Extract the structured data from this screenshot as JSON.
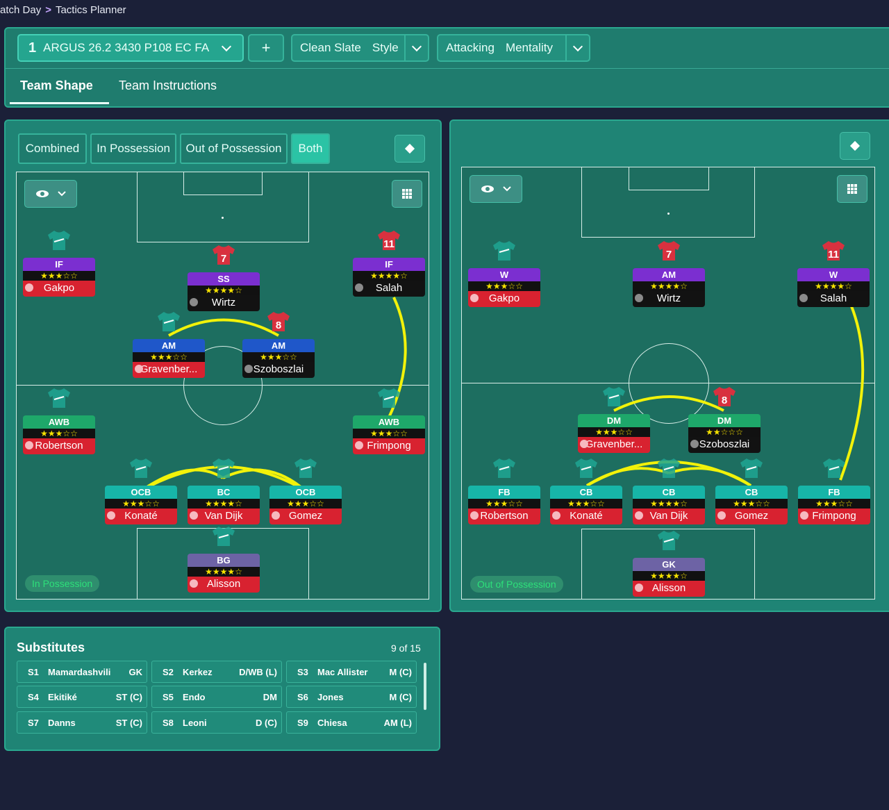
{
  "breadcrumb": {
    "parent": "atch Day",
    "current": "Tactics Planner"
  },
  "tactic": {
    "number": "1",
    "name": "ARGUS 26.2 3430 P108 EC FA",
    "add_label": "+"
  },
  "style": {
    "value": "Clean Slate",
    "label": "Style"
  },
  "mentality": {
    "value": "Attacking",
    "label": "Mentality"
  },
  "tabs": [
    "Team Shape",
    "Team Instructions"
  ],
  "view_modes": [
    "Combined",
    "In Possession",
    "Out of Possession",
    "Both"
  ],
  "active_view": "Both",
  "left_pitch": {
    "tag": "In Possession"
  },
  "right_pitch": {
    "tag": "Out of Possession"
  },
  "in_possession_players": [
    {
      "role": "IF",
      "stars": "★★★☆☆",
      "name": "Gakpo",
      "number": ""
    },
    {
      "role": "SS",
      "stars": "★★★★☆",
      "name": "Wirtz",
      "number": "7"
    },
    {
      "role": "IF",
      "stars": "★★★★☆",
      "name": "Salah",
      "number": "11"
    },
    {
      "role": "AM",
      "stars": "★★★☆☆",
      "name": "Gravenber...",
      "number": ""
    },
    {
      "role": "AM",
      "stars": "★★★☆☆",
      "name": "Szoboszlai",
      "number": "8"
    },
    {
      "role": "AWB",
      "stars": "★★★☆☆",
      "name": "Robertson",
      "number": ""
    },
    {
      "role": "AWB",
      "stars": "★★★☆☆",
      "name": "Frimpong",
      "number": ""
    },
    {
      "role": "OCB",
      "stars": "★★★☆☆",
      "name": "Konaté",
      "number": ""
    },
    {
      "role": "BC",
      "stars": "★★★★☆",
      "name": "Van Dijk",
      "number": ""
    },
    {
      "role": "OCB",
      "stars": "★★★☆☆",
      "name": "Gomez",
      "number": ""
    },
    {
      "role": "BG",
      "stars": "★★★★☆",
      "name": "Alisson",
      "number": ""
    }
  ],
  "out_possession_players": [
    {
      "role": "W",
      "stars": "★★★☆☆",
      "name": "Gakpo",
      "number": ""
    },
    {
      "role": "AM",
      "stars": "★★★★☆",
      "name": "Wirtz",
      "number": "7"
    },
    {
      "role": "W",
      "stars": "★★★★☆",
      "name": "Salah",
      "number": "11"
    },
    {
      "role": "DM",
      "stars": "★★★☆☆",
      "name": "Gravenber...",
      "number": ""
    },
    {
      "role": "DM",
      "stars": "★★☆☆☆",
      "name": "Szoboszlai",
      "number": "8"
    },
    {
      "role": "FB",
      "stars": "★★★☆☆",
      "name": "Robertson",
      "number": ""
    },
    {
      "role": "CB",
      "stars": "★★★☆☆",
      "name": "Konaté",
      "number": ""
    },
    {
      "role": "CB",
      "stars": "★★★★☆",
      "name": "Van Dijk",
      "number": ""
    },
    {
      "role": "CB",
      "stars": "★★★☆☆",
      "name": "Gomez",
      "number": ""
    },
    {
      "role": "FB",
      "stars": "★★★☆☆",
      "name": "Frimpong",
      "number": ""
    },
    {
      "role": "GK",
      "stars": "★★★★☆",
      "name": "Alisson",
      "number": ""
    }
  ],
  "substitutes": {
    "title": "Substitutes",
    "count": "9 of 15",
    "items": [
      {
        "slot": "S1",
        "name": "Mamardashvili",
        "pos": "GK"
      },
      {
        "slot": "S2",
        "name": "Kerkez",
        "pos": "D/WB (L)"
      },
      {
        "slot": "S3",
        "name": "Mac Allister",
        "pos": "M (C)"
      },
      {
        "slot": "S4",
        "name": "Ekitiké",
        "pos": "ST (C)"
      },
      {
        "slot": "S5",
        "name": "Endo",
        "pos": "DM"
      },
      {
        "slot": "S6",
        "name": "Jones",
        "pos": "M (C)"
      },
      {
        "slot": "S7",
        "name": "Danns",
        "pos": "ST (C)"
      },
      {
        "slot": "S8",
        "name": "Leoni",
        "pos": "D (C)"
      },
      {
        "slot": "S9",
        "name": "Chiesa",
        "pos": "AM (L)"
      }
    ]
  },
  "colors": {
    "panel": "#1f8475",
    "accent": "#2bc3a5",
    "link_line": "#f2f20a",
    "name_bar": "#d82230",
    "background": "#1b2038"
  }
}
